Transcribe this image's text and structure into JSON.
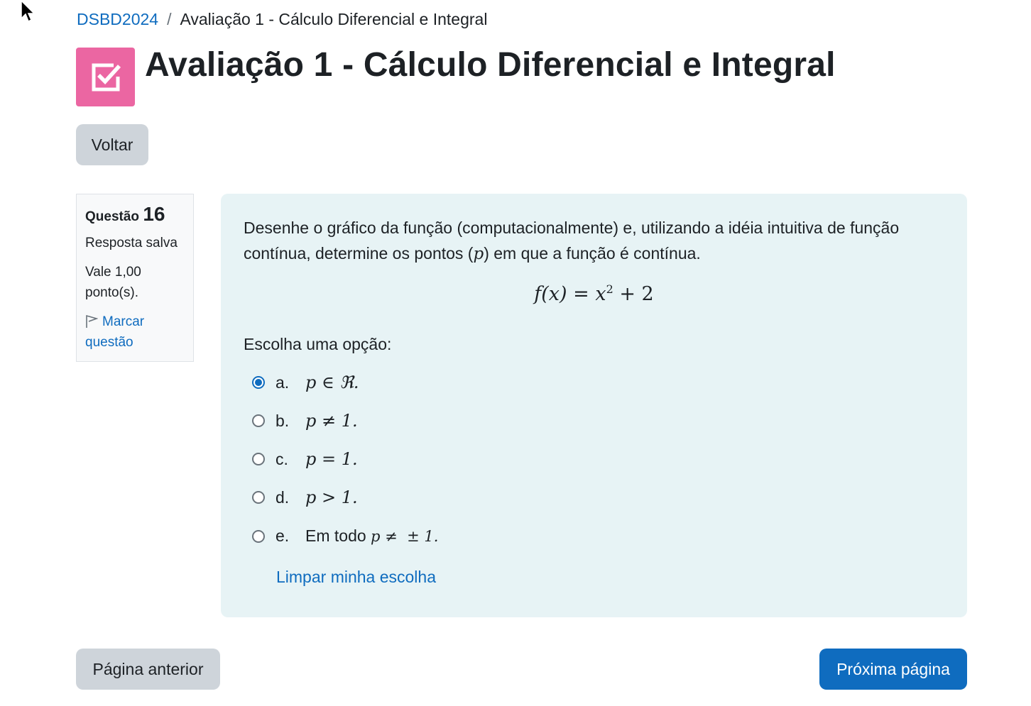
{
  "breadcrumb": {
    "course": "DSBD2024",
    "separator": "/",
    "current": "Avaliação 1 - Cálculo Diferencial e Integral"
  },
  "header": {
    "title": "Avaliação 1 - Cálculo Diferencial e Integral",
    "icon": "quiz-checkbox-icon",
    "icon_color": "#eb66a2"
  },
  "back_button": "Voltar",
  "question_info": {
    "label": "Questão",
    "number": "16",
    "state": "Resposta salva",
    "grade": "Vale 1,00 ponto(s).",
    "flag_label": "Marcar questão"
  },
  "question": {
    "text_before": "Desenhe o gráfico da função (computacionalmente) e, utilizando a idéia intuitiva de função contínua, determine os pontos (",
    "text_var": "p",
    "text_after": ") em que a função é contínua.",
    "formula": {
      "lhs": "f(x) = x",
      "exp": "2",
      "rhs": " + 2"
    },
    "prompt": "Escolha uma opção:",
    "options": [
      {
        "letter": "a.",
        "math": "p ∈ ℜ.",
        "checked": true
      },
      {
        "letter": "b.",
        "math": "p ≠ 1.",
        "checked": false
      },
      {
        "letter": "c.",
        "math": "p = 1.",
        "checked": false
      },
      {
        "letter": "d.",
        "math": "p > 1.",
        "checked": false
      },
      {
        "letter": "e.",
        "text": "Em todo ",
        "math": "p ≠  ± 1.",
        "checked": false
      }
    ],
    "clear_choice": "Limpar minha escolha"
  },
  "nav": {
    "prev": "Página anterior",
    "next": "Próxima página"
  },
  "colors": {
    "primary": "#0f6cbf",
    "question_bg": "#e7f3f5",
    "secondary_button": "#ced4da"
  }
}
